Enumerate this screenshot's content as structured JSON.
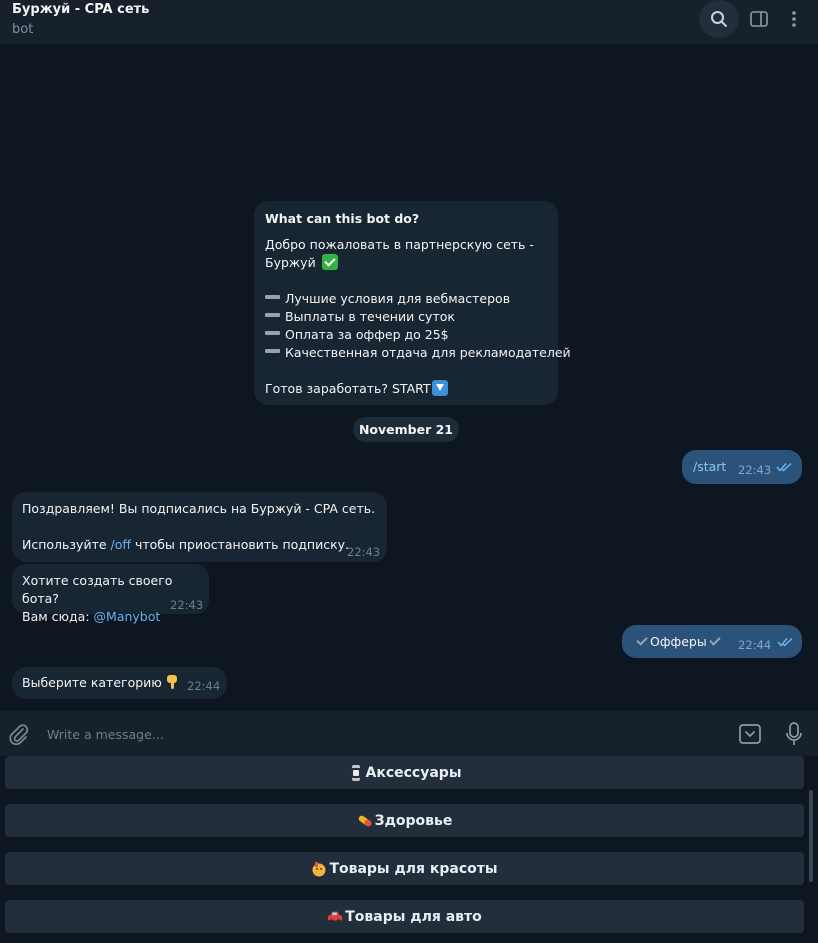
{
  "header": {
    "title": "Буржуй - CPA сеть",
    "subtitle": "bot"
  },
  "intro": {
    "title": "What can this bot do?",
    "welcome_line1": "Добро пожаловать в партнерскую сеть -",
    "welcome_line2": "Буржуй",
    "features": [
      "Лучшие условия для вебмастеров",
      "Выплаты в течении суток",
      "Оплата за оффер до 25$",
      "Качественная отдача для рекламодателей"
    ],
    "cta": "Готов заработать? START"
  },
  "date_separator": "November 21",
  "messages": {
    "start": {
      "text": "/start",
      "time": "22:43"
    },
    "subscribed": {
      "line1": "Поздравляем! Вы подписались на Буржуй - CPA сеть.",
      "line2_before": "Используйте ",
      "line2_link": "/off",
      "line2_after": " чтобы приостановить подписку.",
      "time": "22:43"
    },
    "create_bot": {
      "line1": "Хотите создать своего бота?",
      "line2_before": "Вам сюда: ",
      "line2_link": "@Manybot",
      "time": "22:43"
    },
    "offers": {
      "text": "Офферы",
      "time": "22:44"
    },
    "choose": {
      "text": "Выберите категорию",
      "time": "22:44"
    }
  },
  "composer": {
    "placeholder": "Write a message..."
  },
  "keyboard": {
    "buttons": [
      {
        "label": "Аксессуары",
        "icon": "watch-emoji"
      },
      {
        "label": "Здоровье",
        "icon": "pill-emoji"
      },
      {
        "label": "Товары для красоты",
        "icon": "cosmetics-emoji"
      },
      {
        "label": "Товары для авто",
        "icon": "car-emoji"
      }
    ]
  },
  "colors": {
    "background": "#0e1621",
    "header": "#17212b",
    "incoming_bubble": "#182533",
    "outgoing_bubble": "#2b5278",
    "link": "#6ab3f3",
    "keyboard_button": "#232e3c"
  }
}
